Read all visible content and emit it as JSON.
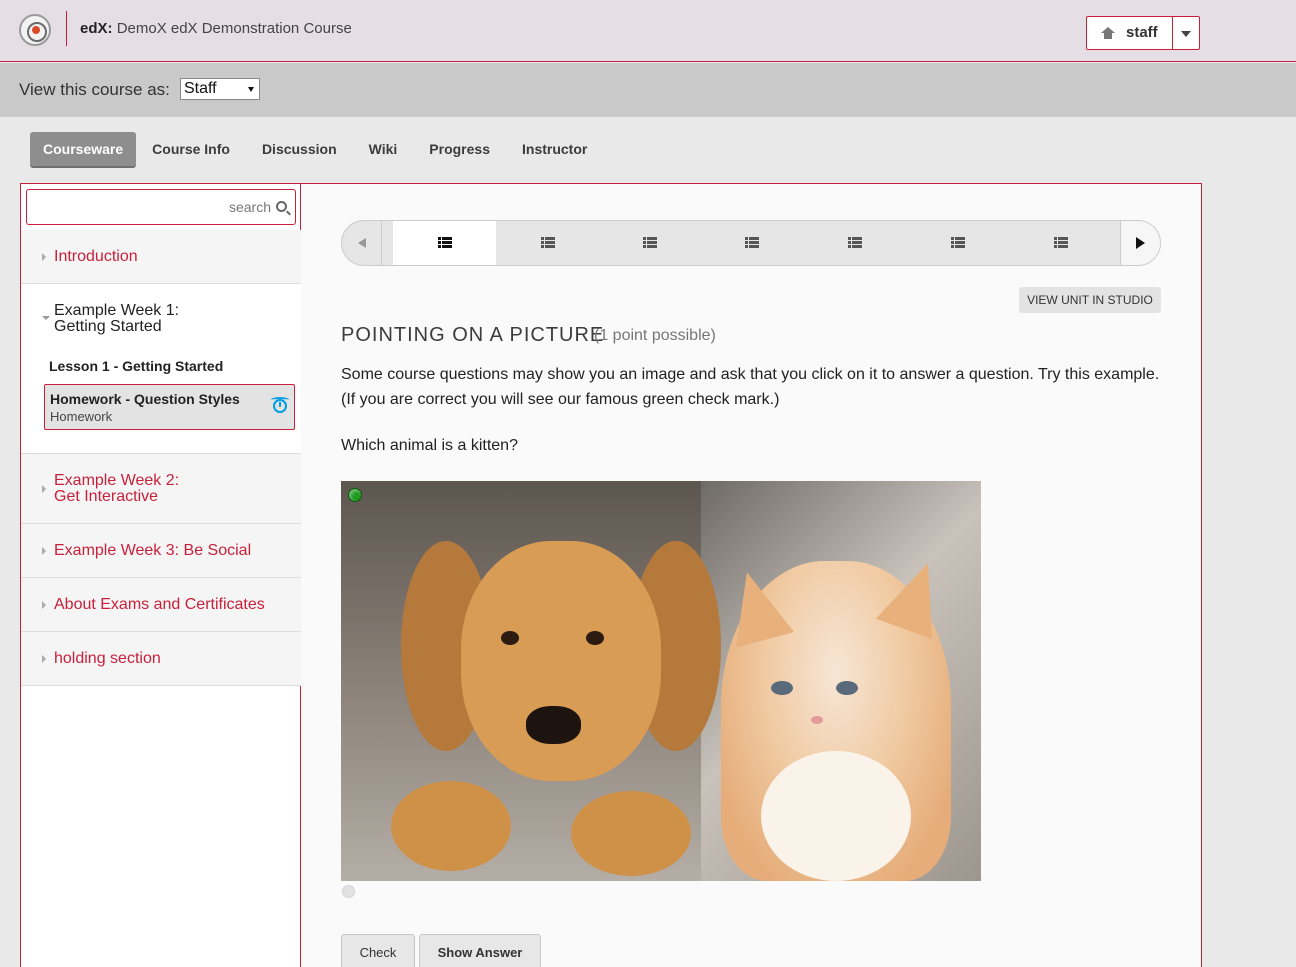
{
  "header": {
    "brand": "edX:",
    "course": "DemoX edX Demonstration Course",
    "username": "staff"
  },
  "view_as": {
    "label": "View this course as:",
    "selected": "Staff"
  },
  "tabs": [
    {
      "label": "Courseware",
      "active": true
    },
    {
      "label": "Course Info"
    },
    {
      "label": "Discussion"
    },
    {
      "label": "Wiki"
    },
    {
      "label": "Progress"
    },
    {
      "label": "Instructor"
    }
  ],
  "sidebar": {
    "search_placeholder": "search",
    "sections": [
      {
        "label": "Introduction"
      },
      {
        "label_line1": "Example Week 1:",
        "label_line2": "Getting Started",
        "open": true
      },
      {
        "label_line1": "Example Week 2:",
        "label_line2": "Get Interactive"
      },
      {
        "label": "Example Week 3: Be Social"
      },
      {
        "label": "About Exams and Certificates"
      },
      {
        "label": "holding section"
      }
    ],
    "lesson": "Lesson 1 - Getting Started",
    "subsection": {
      "title": "Homework - Question Styles",
      "subtitle": "Homework"
    }
  },
  "content": {
    "view_in_studio": "VIEW UNIT IN STUDIO",
    "problem_title": "POINTING ON A PICTURE",
    "points": "(1 point possible)",
    "description": "Some course questions may show you an image and ask that you click on it to answer a question. Try this example. (If you are correct you will see our famous green check mark.)",
    "question": "Which animal is a kitten?",
    "check_label": "Check",
    "show_answer_label": "Show Answer"
  },
  "colors": {
    "accent": "#c81f3a",
    "marker": "#1e9a1e"
  }
}
